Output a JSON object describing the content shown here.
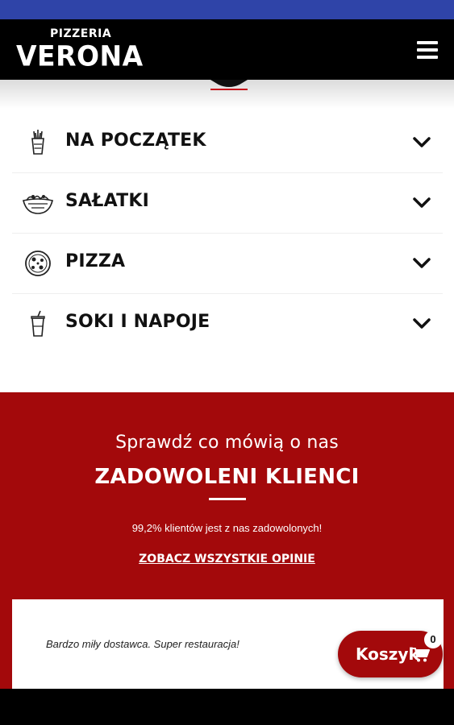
{
  "brand": {
    "small": "PIZZERIA",
    "big": "VERONA"
  },
  "menu": {
    "items": [
      {
        "label": "NA POCZĄTEK",
        "icon": "starter-icon"
      },
      {
        "label": "SAŁATKI",
        "icon": "salad-bowl-icon"
      },
      {
        "label": "PIZZA",
        "icon": "pizza-icon"
      },
      {
        "label": "SOKI I NAPOJE",
        "icon": "drink-cup-icon"
      }
    ]
  },
  "reviews": {
    "subtitle": "Sprawdź co mówią o nas",
    "title": "ZADOWOLENI KLIENCI",
    "stat": "99,2% klientów jest z nas zadowolonych!",
    "link": "ZOBACZ WSZYSTKIE OPINIE",
    "quote": "Bardzo miły dostawca. Super restauracja!"
  },
  "cart": {
    "label": "Koszyk",
    "count": "0"
  },
  "colors": {
    "accent": "#a3090b",
    "header": "#000000",
    "status_bar": "#2f44a8"
  }
}
